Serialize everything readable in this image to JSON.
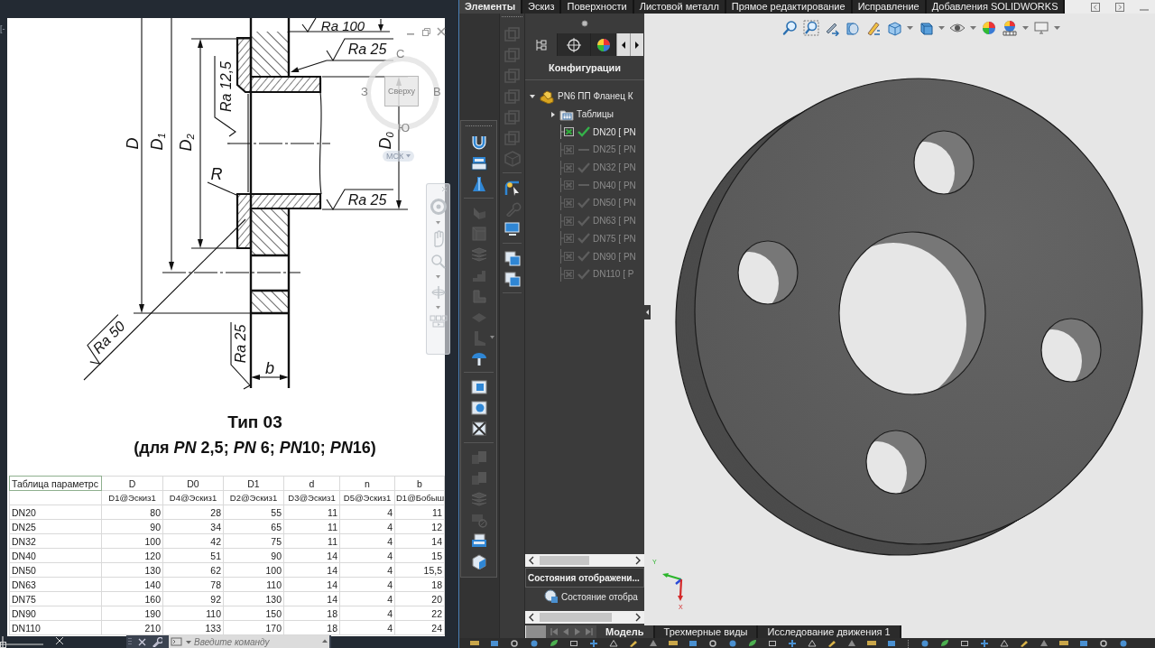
{
  "autocad": {
    "viewport_label": "[-",
    "drawing_labels": [
      {
        "kind": "roughness",
        "text": "Ra 100"
      },
      {
        "kind": "roughness",
        "text": "Ra 25"
      },
      {
        "kind": "roughness",
        "text": "Ra 12,5"
      },
      {
        "kind": "dimension",
        "text": "D"
      },
      {
        "kind": "dimension",
        "text": "D$_{1}$"
      },
      {
        "kind": "dimension",
        "text": "D$_{2}$"
      },
      {
        "kind": "dimension",
        "text": "R"
      },
      {
        "kind": "dimension",
        "text": "D$_{0}$"
      },
      {
        "kind": "roughness",
        "text": "Ra 25"
      },
      {
        "kind": "roughness",
        "text": "Ra 50"
      },
      {
        "kind": "roughness",
        "text": "Ra 25"
      },
      {
        "kind": "dimension",
        "text": "b"
      }
    ],
    "caption": {
      "title": "Тип 03",
      "subtitle": [
        {
          "text": "(для ",
          "italic": false
        },
        {
          "text": "PN",
          "italic": true
        },
        {
          "text": " 2,5; ",
          "italic": false
        },
        {
          "text": "PN",
          "italic": true
        },
        {
          "text": " 6; ",
          "italic": false
        },
        {
          "text": "PN",
          "italic": true
        },
        {
          "text": "10; ",
          "italic": false
        },
        {
          "text": "PN",
          "italic": true
        },
        {
          "text": "16)",
          "italic": false
        }
      ]
    },
    "table": {
      "columns": [
        "Таблица параметрс",
        "D",
        "D0",
        "D1",
        "d",
        "n",
        "b"
      ],
      "variables": [
        "D1@Эскиз1",
        "D4@Эскиз1",
        "D2@Эскиз1",
        "D3@Эскиз1",
        "D5@Эскиз1",
        "D1@Бобыш"
      ],
      "rows": [
        [
          "DN20",
          "80",
          "28",
          "55",
          "11",
          "4",
          "11"
        ],
        [
          "DN25",
          "90",
          "34",
          "65",
          "11",
          "4",
          "12"
        ],
        [
          "DN32",
          "100",
          "42",
          "75",
          "11",
          "4",
          "14"
        ],
        [
          "DN40",
          "120",
          "51",
          "90",
          "14",
          "4",
          "15"
        ],
        [
          "DN50",
          "130",
          "62",
          "100",
          "14",
          "4",
          "15,5"
        ],
        [
          "DN63",
          "140",
          "78",
          "110",
          "14",
          "4",
          "18"
        ],
        [
          "DN75",
          "160",
          "92",
          "130",
          "14",
          "4",
          "20"
        ],
        [
          "DN90",
          "190",
          "110",
          "150",
          "18",
          "4",
          "22"
        ],
        [
          "DN110",
          "210",
          "133",
          "170",
          "18",
          "4",
          "24"
        ]
      ]
    },
    "viewcube": {
      "north": "С",
      "west": "З",
      "east": "В",
      "south": "Ю",
      "face": "Сверху",
      "ucs": "МСК"
    },
    "command_line": {
      "placeholder": "Введите команду"
    }
  },
  "solidworks": {
    "ribbon_tabs": [
      {
        "label": "Элементы",
        "selected": true
      },
      {
        "label": "Эскиз",
        "selected": false
      },
      {
        "label": "Поверхности",
        "selected": false
      },
      {
        "label": "Листовой металл",
        "selected": false
      },
      {
        "label": "Прямое редактирование",
        "selected": false
      },
      {
        "label": "Исправление",
        "selected": false
      },
      {
        "label": "Добавления SOLIDWORKS",
        "selected": false
      }
    ],
    "panel_tabs": [
      {
        "selected": true
      },
      {
        "selected": false
      },
      {
        "selected": false
      }
    ],
    "panel_title": "Конфигурации",
    "tree": [
      {
        "label": "PN6 ПП Фланец К",
        "kind": "part",
        "expanded": true,
        "children": [
          {
            "label": "Таблицы",
            "kind": "folder",
            "expanded": false
          },
          {
            "label": "DN20 [ PN",
            "kind": "config",
            "selected": true,
            "up_to_date": true
          },
          {
            "label": "DN25 [ PN",
            "kind": "config",
            "selected": false,
            "up_to_date": false
          },
          {
            "label": "DN32 [ PN",
            "kind": "config",
            "selected": false,
            "up_to_date": true
          },
          {
            "label": "DN40 [ PN",
            "kind": "config",
            "selected": false,
            "up_to_date": false
          },
          {
            "label": "DN50 [ PN",
            "kind": "config",
            "selected": false,
            "up_to_date": true
          },
          {
            "label": "DN63 [ PN",
            "kind": "config",
            "selected": false,
            "up_to_date": true
          },
          {
            "label": "DN75 [ PN",
            "kind": "config",
            "selected": false,
            "up_to_date": true
          },
          {
            "label": "DN90 [ PN",
            "kind": "config",
            "selected": false,
            "up_to_date": true
          },
          {
            "label": "DN110 [ P",
            "kind": "config",
            "selected": false,
            "up_to_date": true
          }
        ]
      }
    ],
    "display_states": {
      "header": "Состояния отображени...",
      "items": [
        {
          "label": "Состояние отобра"
        }
      ]
    },
    "model_tabs": [
      {
        "label": "Модель",
        "selected": true
      },
      {
        "label": "Трехмерные виды",
        "selected": false
      },
      {
        "label": "Исследование движения 1",
        "selected": false
      }
    ],
    "triad": {
      "y_label": "Y",
      "x_label": "X"
    }
  }
}
